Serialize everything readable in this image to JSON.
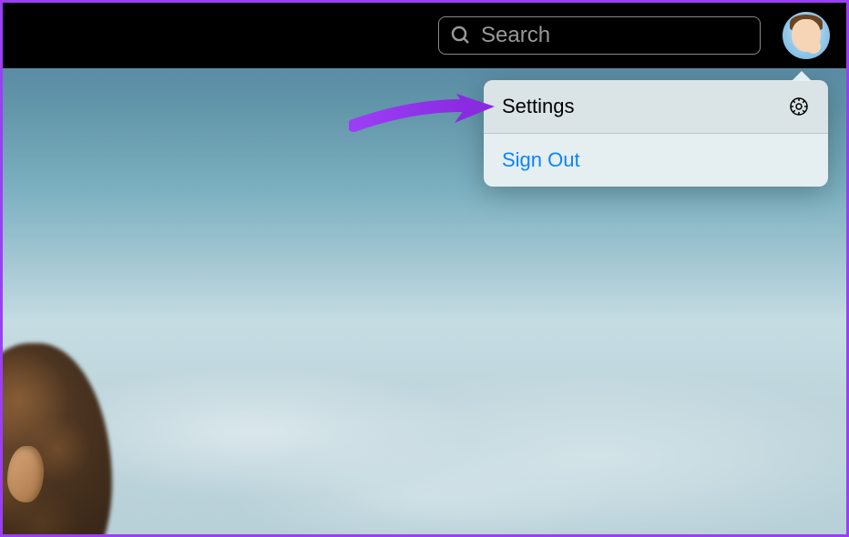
{
  "topbar": {
    "search": {
      "placeholder": "Search",
      "value": ""
    }
  },
  "dropdown": {
    "items": [
      {
        "label": "Settings",
        "has_icon": true
      },
      {
        "label": "Sign Out",
        "has_icon": false
      }
    ]
  },
  "colors": {
    "accent": "#0a84ff",
    "arrow": "#9b3ef5",
    "border": "#9b3ef5"
  }
}
